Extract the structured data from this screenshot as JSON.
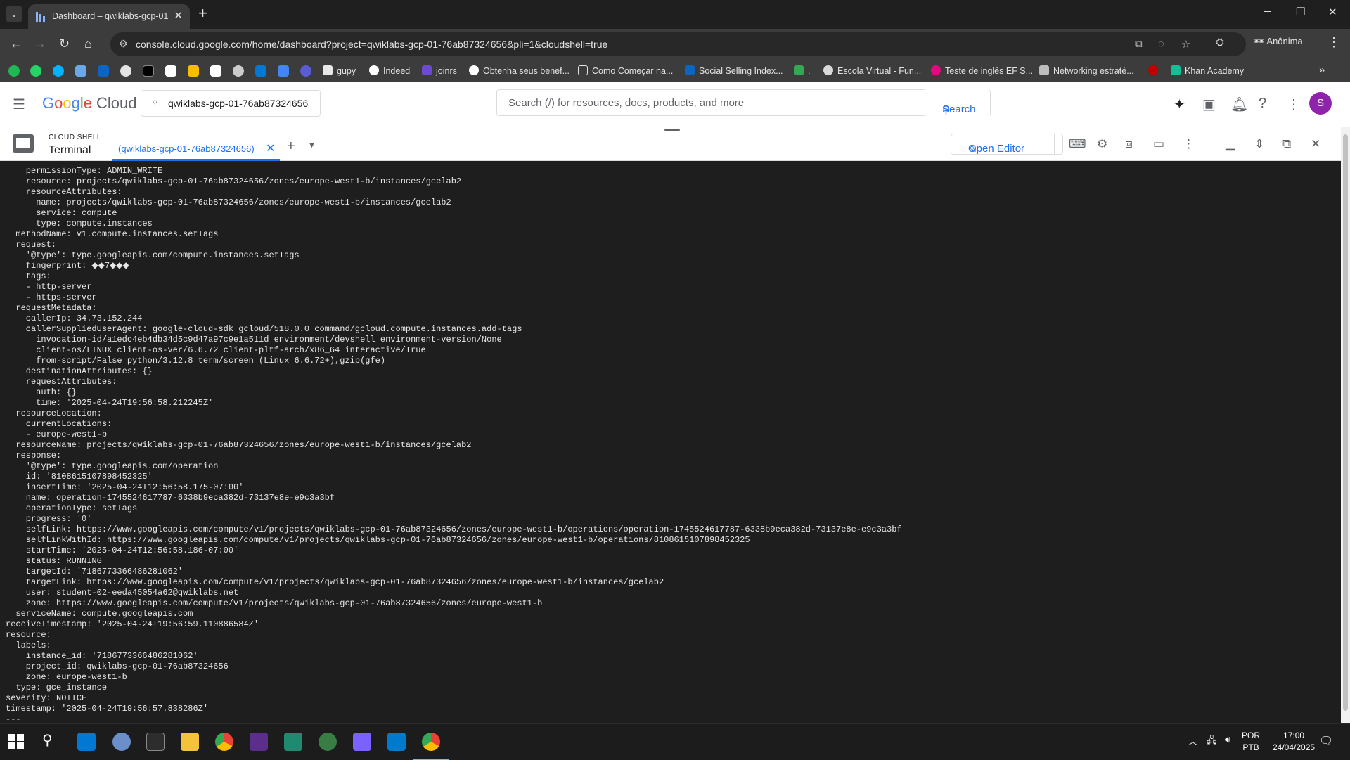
{
  "browser": {
    "tab_title": "Dashboard – qwiklabs-gcp-01-",
    "url": "console.cloud.google.com/home/dashboard?project=qwiklabs-gcp-01-76ab87324656&pli=1&cloudshell=true",
    "profile": "Anônima",
    "bookmarks": [
      {
        "label": "gupy",
        "color": "#e8e8e8"
      },
      {
        "label": "Indeed",
        "color": "#ffffff"
      },
      {
        "label": "joinrs",
        "color": "#6c4bd1"
      },
      {
        "label": "Obtenha seus benef...",
        "color": "#ffffff"
      },
      {
        "label": "Como Começar na...",
        "color": "#e3e3e3"
      },
      {
        "label": "Social Selling Index...",
        "color": "#0a66c2"
      },
      {
        "label": ".",
        "color": "#34a853"
      },
      {
        "label": "Escola Virtual - Fun...",
        "color": "#d9d9d9"
      },
      {
        "label": "Teste de inglês EF S...",
        "color": "#e5097f"
      },
      {
        "label": "Networking estraté...",
        "color": "#bdbdbd"
      },
      {
        "label": "",
        "color": "#c00000"
      },
      {
        "label": "Khan Academy",
        "color": "#14bf96"
      }
    ]
  },
  "gcp": {
    "brand": "Google Cloud",
    "project": "qwiklabs-gcp-01-76ab87324656",
    "search_placeholder": "Search (/) for resources, docs, products, and more",
    "search_button": "Search",
    "avatar_initial": "S"
  },
  "shell": {
    "section": "CLOUD SHELL",
    "title": "Terminal",
    "tab_label": "(qwiklabs-gcp-01-76ab87324656)",
    "open_editor": "Open Editor"
  },
  "terminal_lines": [
    "    permissionType: ADMIN_WRITE",
    "    resource: projects/qwiklabs-gcp-01-76ab87324656/zones/europe-west1-b/instances/gcelab2",
    "    resourceAttributes:",
    "      name: projects/qwiklabs-gcp-01-76ab87324656/zones/europe-west1-b/instances/gcelab2",
    "      service: compute",
    "      type: compute.instances",
    "  methodName: v1.compute.instances.setTags",
    "  request:",
    "    '@type': type.googleapis.com/compute.instances.setTags",
    "    fingerprint: ◆◆7◆◆◆",
    "    tags:",
    "    - http-server",
    "    - https-server",
    "  requestMetadata:",
    "    callerIp: 34.73.152.244",
    "    callerSuppliedUserAgent: google-cloud-sdk gcloud/518.0.0 command/gcloud.compute.instances.add-tags",
    "      invocation-id/a1edc4eb4db34d5c9d47a97c9e1a511d environment/devshell environment-version/None",
    "      client-os/LINUX client-os-ver/6.6.72 client-pltf-arch/x86_64 interactive/True",
    "      from-script/False python/3.12.8 term/screen (Linux 6.6.72+),gzip(gfe)",
    "    destinationAttributes: {}",
    "    requestAttributes:",
    "      auth: {}",
    "      time: '2025-04-24T19:56:58.212245Z'",
    "  resourceLocation:",
    "    currentLocations:",
    "    - europe-west1-b",
    "  resourceName: projects/qwiklabs-gcp-01-76ab87324656/zones/europe-west1-b/instances/gcelab2",
    "  response:",
    "    '@type': type.googleapis.com/operation",
    "    id: '8108615107898452325'",
    "    insertTime: '2025-04-24T12:56:58.175-07:00'",
    "    name: operation-1745524617787-6338b9eca382d-73137e8e-e9c3a3bf",
    "    operationType: setTags",
    "    progress: '0'",
    "    selfLink: https://www.googleapis.com/compute/v1/projects/qwiklabs-gcp-01-76ab87324656/zones/europe-west1-b/operations/operation-1745524617787-6338b9eca382d-73137e8e-e9c3a3bf",
    "    selfLinkWithId: https://www.googleapis.com/compute/v1/projects/qwiklabs-gcp-01-76ab87324656/zones/europe-west1-b/operations/8108615107898452325",
    "    startTime: '2025-04-24T12:56:58.186-07:00'",
    "    status: RUNNING",
    "    targetId: '7186773366486281062'",
    "    targetLink: https://www.googleapis.com/compute/v1/projects/qwiklabs-gcp-01-76ab87324656/zones/europe-west1-b/instances/gcelab2",
    "    user: student-02-eeda45054a62@qwiklabs.net",
    "    zone: https://www.googleapis.com/compute/v1/projects/qwiklabs-gcp-01-76ab87324656/zones/europe-west1-b",
    "  serviceName: compute.googleapis.com",
    "receiveTimestamp: '2025-04-24T19:56:59.110886584Z'",
    "resource:",
    "  labels:",
    "    instance_id: '7186773366486281062'",
    "    project_id: qwiklabs-gcp-01-76ab87324656",
    "    zone: europe-west1-b",
    "  type: gce_instance",
    "severity: NOTICE",
    "timestamp: '2025-04-24T19:56:57.838286Z'",
    "---"
  ],
  "taskbar": {
    "lang_top": "POR",
    "lang_bottom": "PTB",
    "time": "17:00",
    "date": "24/04/2025"
  }
}
